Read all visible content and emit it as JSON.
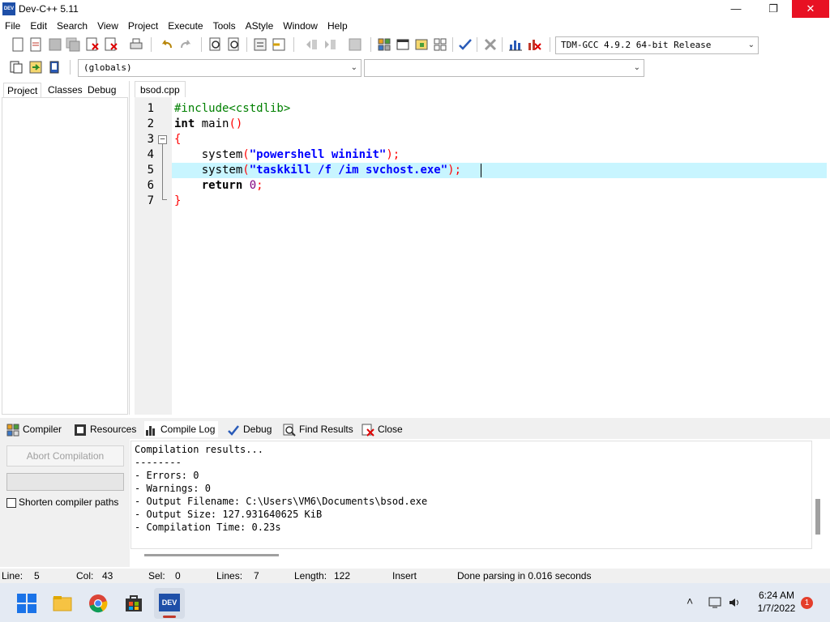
{
  "window": {
    "title": "Dev-C++ 5.11",
    "app_icon_text": "DEV"
  },
  "menu": [
    "File",
    "Edit",
    "Search",
    "View",
    "Project",
    "Execute",
    "Tools",
    "AStyle",
    "Window",
    "Help"
  ],
  "toolbar": {
    "compiler_select": "TDM-GCC 4.9.2 64-bit Release",
    "scope_select": "(globals)",
    "member_select": ""
  },
  "left_tabs": [
    "Project",
    "Classes",
    "Debug"
  ],
  "editor": {
    "file_tab": "bsod.cpp",
    "line_numbers": [
      "1",
      "2",
      "3",
      "4",
      "5",
      "6",
      "7"
    ],
    "lines": [
      "#include<cstdlib>",
      "int main()",
      "{",
      "    system(\"powershell wininit\");",
      "    system(\"taskkill /f /im svchost.exe\");",
      "    return 0;",
      "}"
    ],
    "current_line": 5
  },
  "bottom_tabs": [
    "Compiler",
    "Resources",
    "Compile Log",
    "Debug",
    "Find Results",
    "Close"
  ],
  "compile_panel": {
    "abort_label": "Abort Compilation",
    "shorten_label": "Shorten compiler paths",
    "log": [
      "Compilation results...",
      "--------",
      "- Errors: 0",
      "- Warnings: 0",
      "- Output Filename: C:\\Users\\VM6\\Documents\\bsod.exe",
      "- Output Size: 127.931640625 KiB",
      "- Compilation Time: 0.23s"
    ]
  },
  "status": {
    "line_label": "Line:",
    "line_value": "5",
    "col_label": "Col:",
    "col_value": "43",
    "sel_label": "Sel:",
    "sel_value": "0",
    "lines_label": "Lines:",
    "lines_value": "7",
    "length_label": "Length:",
    "length_value": "122",
    "mode": "Insert",
    "message": "Done parsing in 0.016 seconds"
  },
  "taskbar": {
    "time": "6:24 AM",
    "date": "1/7/2022",
    "notifications": "1",
    "active_app_text": "DEV"
  }
}
